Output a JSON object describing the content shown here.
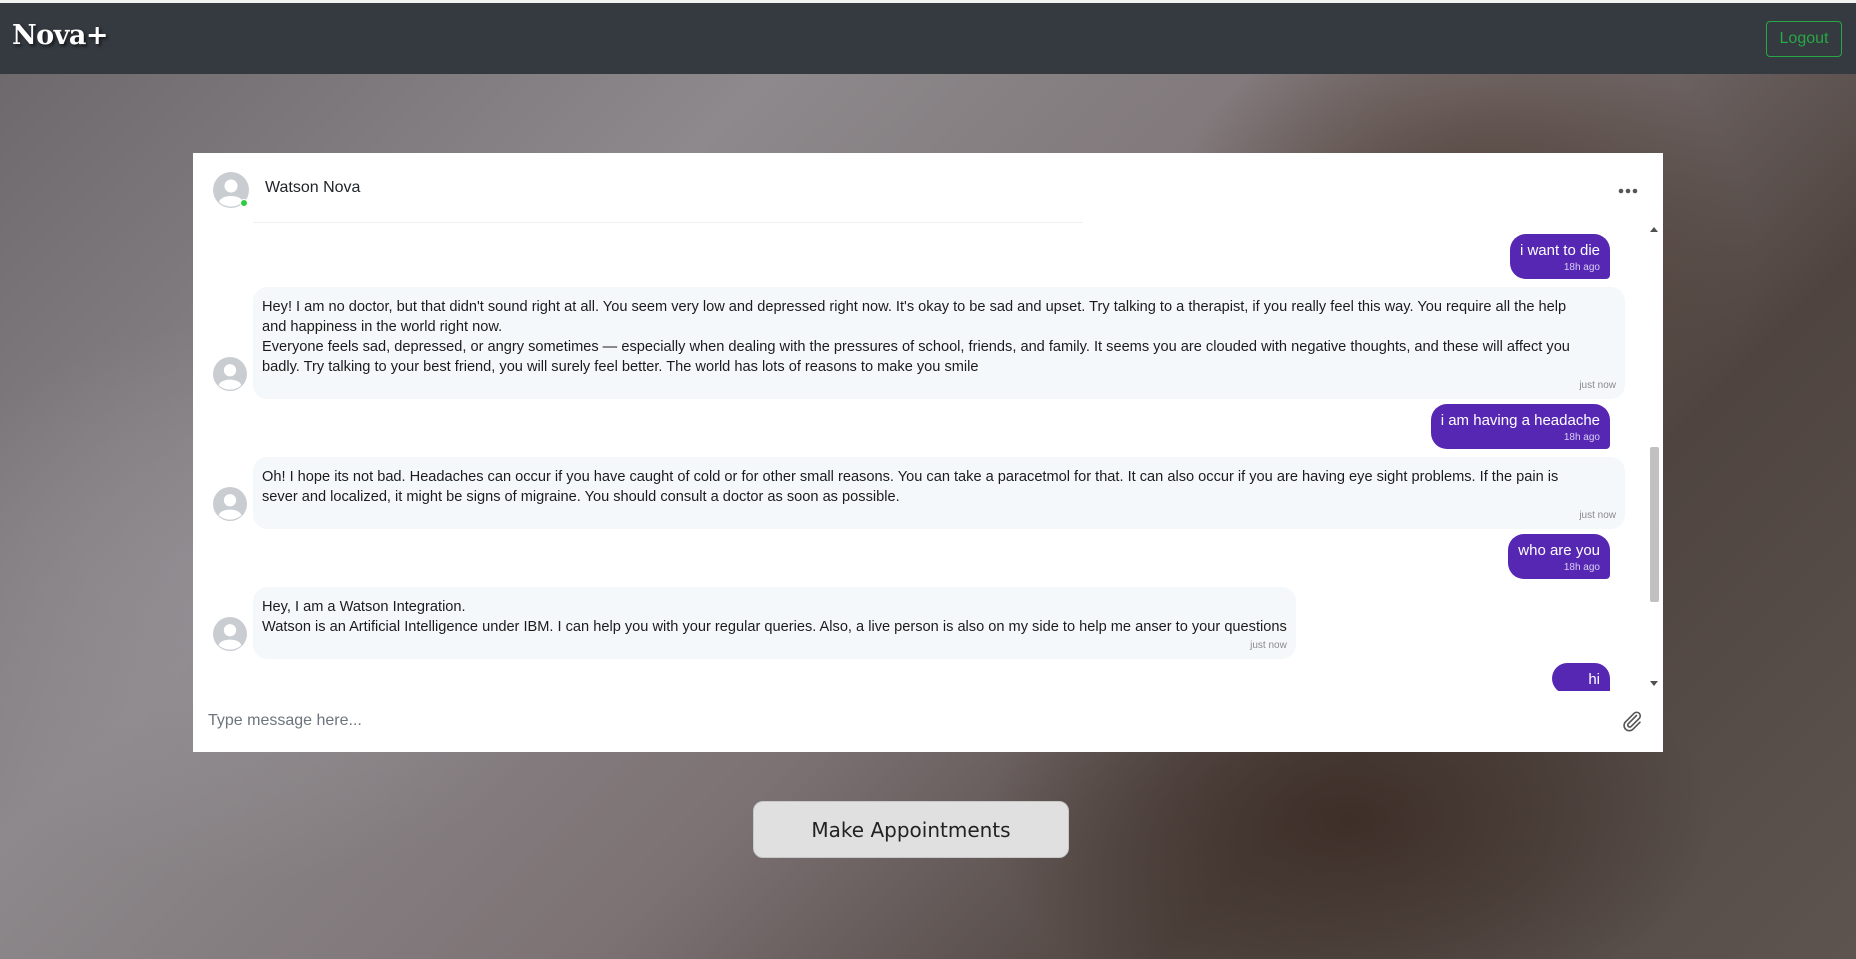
{
  "navbar": {
    "brand": "Nova+",
    "logout_label": "Logout"
  },
  "chat": {
    "contact_name": "Watson Nova",
    "input_placeholder": "Type message here...",
    "messages": [
      {
        "from": "user",
        "text": "i want to die",
        "time": "18h ago"
      },
      {
        "from": "bot",
        "lines": [
          "Hey! I am no doctor, but that didn't sound right at all. You seem very low and depressed right now. It's okay to be sad and upset. Try talking to a therapist, if you really feel this way. You require all the help",
          "and happiness in the world right now.",
          "Everyone feels sad, depressed, or angry sometimes — especially when dealing with the pressures of school, friends, and family. It seems you are clouded with negative thoughts, and these will affect you",
          "badly. Try talking to your best friend, you will surely feel better. The world has lots of reasons to make you smile"
        ],
        "time": "just now"
      },
      {
        "from": "user",
        "text": "i am having a headache",
        "time": "18h ago"
      },
      {
        "from": "bot",
        "lines": [
          "Oh! I hope its not bad. Headaches can occur if you have caught of cold or for other small reasons. You can take a paracetmol for that. It can also occur if you are having eye sight problems. If the pain is",
          "sever and localized, it might be signs of migraine. You should consult a doctor as soon as possible."
        ],
        "time": "just now"
      },
      {
        "from": "user",
        "text": "who are you",
        "time": "18h ago"
      },
      {
        "from": "bot",
        "lines": [
          "Hey, I am a Watson Integration.",
          "Watson is an Artificial Intelligence under IBM. I can help you with your regular queries. Also, a live person is also on my side to help me anser to your questions"
        ],
        "time": "just now"
      },
      {
        "from": "user",
        "text": "hi",
        "time": ""
      }
    ]
  },
  "appointments_label": "Make Appointments",
  "colors": {
    "navbar_bg": "#343a40",
    "logout_green": "#28a745",
    "user_bubble": "#5627b3",
    "bot_bubble": "#f5f8fa"
  }
}
